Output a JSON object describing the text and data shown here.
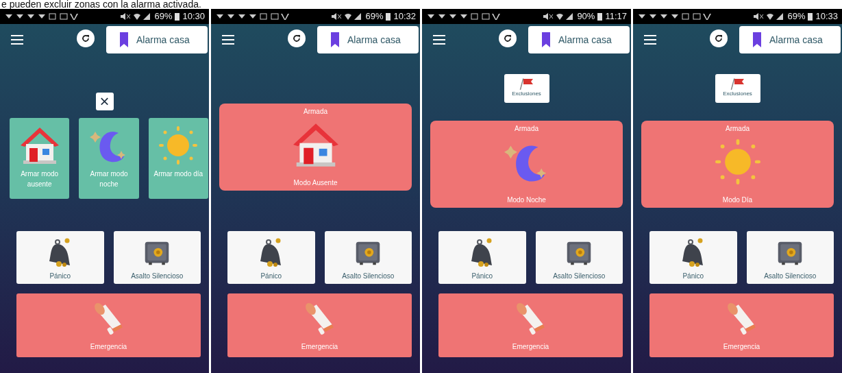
{
  "caption": "e pueden excluir zonas con la alarma activada.",
  "screens": [
    {
      "status_bar": {
        "battery": "69%",
        "time": "10:30"
      },
      "header": {
        "title": "Alarma casa"
      },
      "kind": "mode_picker",
      "close_button": "×",
      "mode_options": [
        {
          "label": "Armar modo ausente",
          "kind": "house"
        },
        {
          "label": "Armar modo noche",
          "kind": "moon"
        },
        {
          "label": "Armar modo día",
          "kind": "sun"
        }
      ],
      "actions": [
        {
          "label": "Pánico",
          "kind": "bell"
        },
        {
          "label": "Asalto Silencioso",
          "kind": "safe"
        }
      ],
      "emergency": {
        "label": "Emergencia"
      }
    },
    {
      "status_bar": {
        "battery": "69%",
        "time": "10:32"
      },
      "header": {
        "title": "Alarma casa"
      },
      "kind": "armed",
      "armed_card": {
        "status": "Armada",
        "mode": "Modo Ausente",
        "kind": "house"
      },
      "actions": [
        {
          "label": "Pánico",
          "kind": "bell"
        },
        {
          "label": "Asalto Silencioso",
          "kind": "safe"
        }
      ],
      "emergency": {
        "label": "Emergencia"
      }
    },
    {
      "status_bar": {
        "battery": "90%",
        "time": "11:17"
      },
      "header": {
        "title": "Alarma casa"
      },
      "kind": "armed",
      "exclusions_button": {
        "label": "Exclusiones"
      },
      "armed_card": {
        "status": "Armada",
        "mode": "Modo Noche",
        "kind": "moon"
      },
      "actions": [
        {
          "label": "Pánico",
          "kind": "bell"
        },
        {
          "label": "Asalto Silencioso",
          "kind": "safe"
        }
      ],
      "emergency": {
        "label": "Emergencia"
      }
    },
    {
      "status_bar": {
        "battery": "69%",
        "time": "10:33"
      },
      "header": {
        "title": "Alarma casa"
      },
      "kind": "armed",
      "exclusions_button": {
        "label": "Exclusiones"
      },
      "armed_card": {
        "status": "Armada",
        "mode": "Modo Día",
        "kind": "sun"
      },
      "actions": [
        {
          "label": "Pánico",
          "kind": "bell"
        },
        {
          "label": "Asalto Silencioso",
          "kind": "safe"
        }
      ],
      "emergency": {
        "label": "Emergencia"
      }
    }
  ]
}
